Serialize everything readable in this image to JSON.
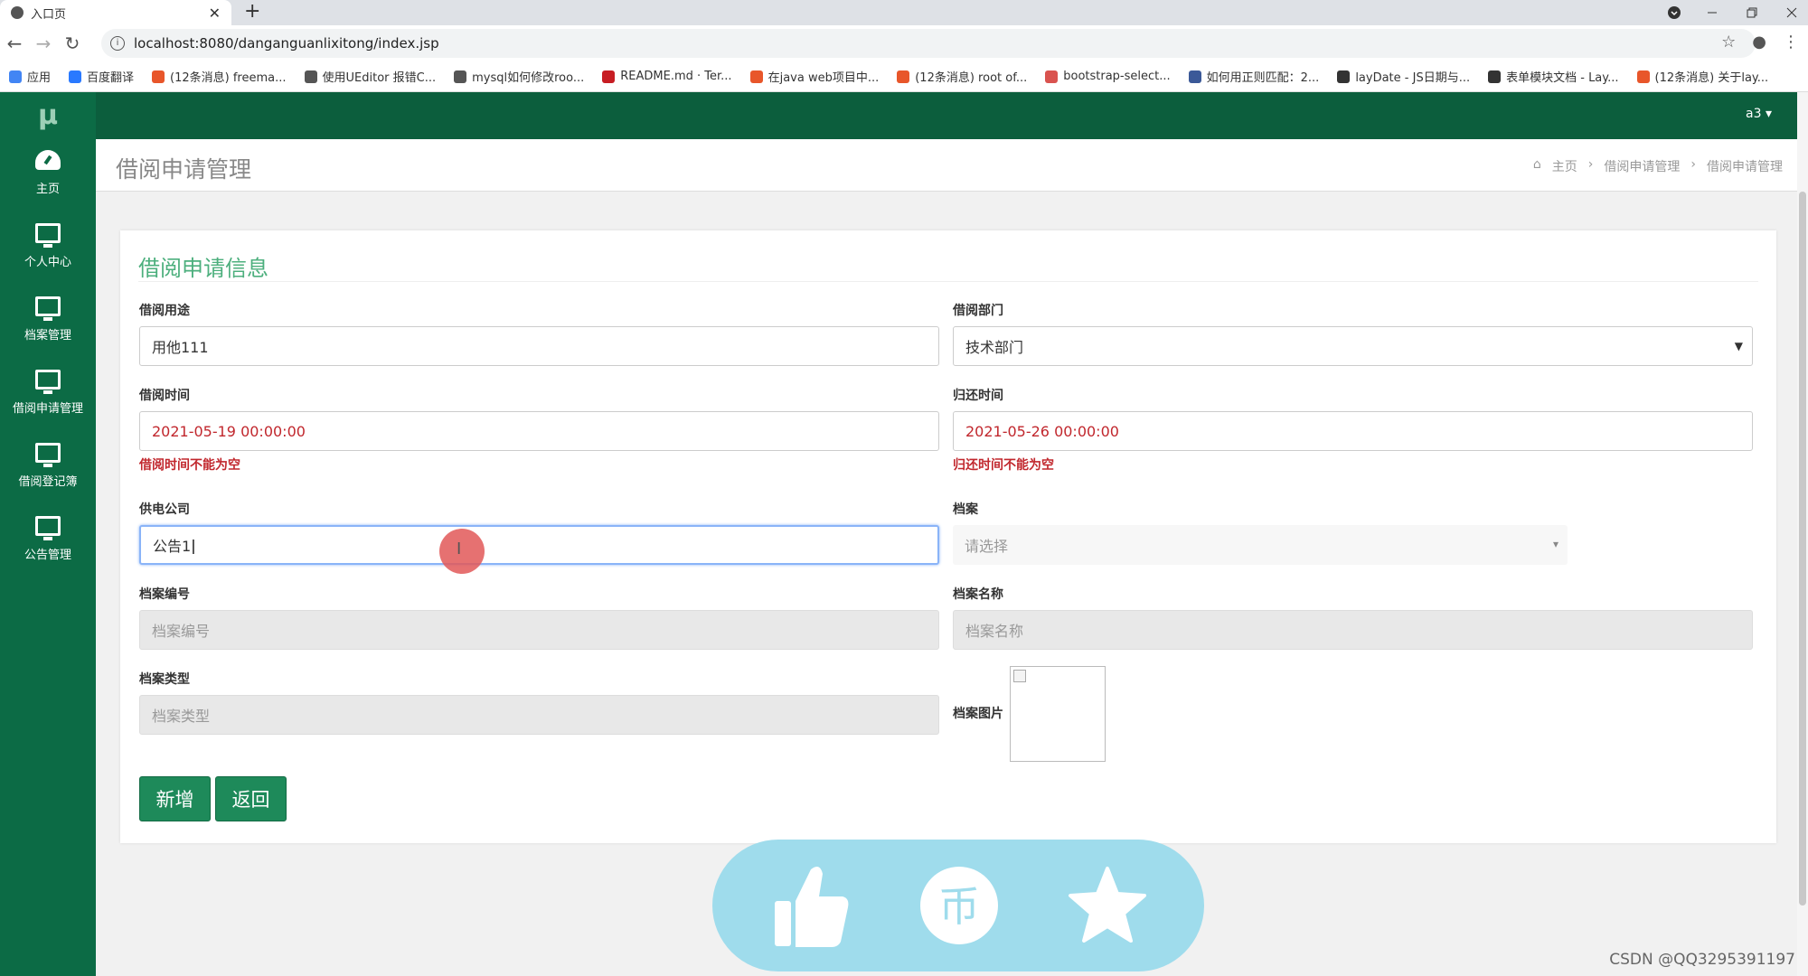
{
  "browser": {
    "tab_title": "入口页",
    "tab_close": "✕",
    "new_tab": "+",
    "url": "localhost:8080/danganguanlixitong/index.jsp",
    "bookmarks": [
      {
        "label": "应用",
        "color": "#4285f4"
      },
      {
        "label": "百度翻译",
        "color": "#2979ff"
      },
      {
        "label": "(12条消息) freema...",
        "color": "#e8562a"
      },
      {
        "label": "使用UEditor 报错C...",
        "color": "#555555"
      },
      {
        "label": "mysql如何修改roo...",
        "color": "#555555"
      },
      {
        "label": "README.md · Ter...",
        "color": "#c71d23"
      },
      {
        "label": "在java web项目中...",
        "color": "#e8562a"
      },
      {
        "label": "(12条消息) root of...",
        "color": "#e8562a"
      },
      {
        "label": "bootstrap-select...",
        "color": "#d9534f"
      },
      {
        "label": "如何用正则匹配：2...",
        "color": "#3b5998"
      },
      {
        "label": "layDate - JS日期与...",
        "color": "#333333"
      },
      {
        "label": "表单模块文档 - Lay...",
        "color": "#333333"
      },
      {
        "label": "(12条消息) 关于lay...",
        "color": "#e8562a"
      }
    ]
  },
  "app": {
    "logo": "μ",
    "user": "a3 ▾",
    "sidebar": [
      {
        "label": "主页",
        "name": "home"
      },
      {
        "label": "个人中心",
        "name": "personal-center"
      },
      {
        "label": "档案管理",
        "name": "archive-management"
      },
      {
        "label": "借阅申请管理",
        "name": "borrow-application-management"
      },
      {
        "label": "借阅登记簿",
        "name": "borrow-register"
      },
      {
        "label": "公告管理",
        "name": "notice-management"
      }
    ],
    "page_title": "借阅申请管理",
    "breadcrumb": [
      "主页",
      "借阅申请管理",
      "借阅申请管理"
    ]
  },
  "form": {
    "title": "借阅申请信息",
    "purpose_label": "借阅用途",
    "purpose_value": "用他111",
    "dept_label": "借阅部门",
    "dept_value": "技术部门",
    "borrow_time_label": "借阅时间",
    "borrow_time_value": "2021-05-19 00:00:00",
    "borrow_time_error": "借阅时间不能为空",
    "return_time_label": "归还时间",
    "return_time_value": "2021-05-26 00:00:00",
    "return_time_error": "归还时间不能为空",
    "company_label": "供电公司",
    "company_value": "公告1",
    "archive_label": "档案",
    "archive_placeholder": "请选择",
    "archive_no_label": "档案编号",
    "archive_no_placeholder": "档案编号",
    "archive_name_label": "档案名称",
    "archive_name_placeholder": "档案名称",
    "archive_type_label": "档案类型",
    "archive_type_placeholder": "档案类型",
    "archive_image_label": "档案图片",
    "add_button": "新增",
    "back_button": "返回"
  },
  "reactions": {
    "coin_glyph": "币"
  },
  "watermark": "CSDN @QQ3295391197"
}
